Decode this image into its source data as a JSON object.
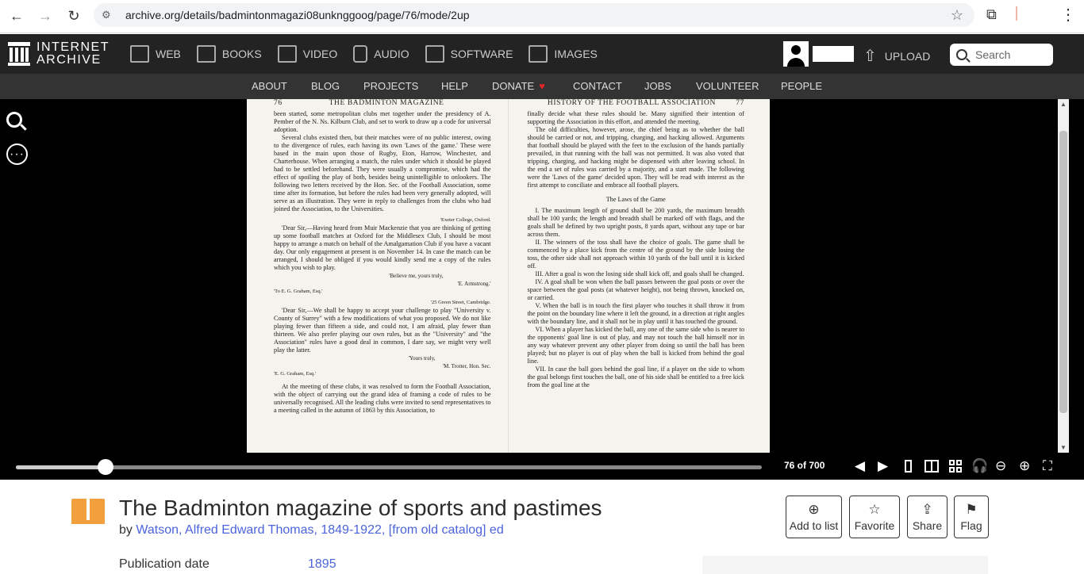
{
  "browser": {
    "url": "archive.org/details/badmintonmagazi08unknggoog/page/76/mode/2up"
  },
  "ia_nav": {
    "logo_line1": "INTERNET",
    "logo_line2": "ARCHIVE",
    "media": [
      {
        "label": "WEB",
        "icon": "web-icon"
      },
      {
        "label": "BOOKS",
        "icon": "books-icon"
      },
      {
        "label": "VIDEO",
        "icon": "video-icon"
      },
      {
        "label": "AUDIO",
        "icon": "audio-icon"
      },
      {
        "label": "SOFTWARE",
        "icon": "software-icon"
      },
      {
        "label": "IMAGES",
        "icon": "images-icon"
      }
    ],
    "upload_label": "UPLOAD",
    "search_placeholder": "Search",
    "sub": [
      "ABOUT",
      "BLOG",
      "PROJECTS",
      "HELP",
      "DONATE",
      "CONTACT",
      "JOBS",
      "VOLUNTEER",
      "PEOPLE"
    ]
  },
  "book": {
    "left_page_number": "76",
    "left_running_head": "THE BADMINTON MAGAZINE",
    "right_running_head": "HISTORY OF THE FOOTBALL ASSOCIATION",
    "right_page_number": "77",
    "left_text": [
      "been started, some metropolitan clubs met together under the presidency of A. Pember of the N. Ns. Kilburn Club, and set to work to draw up a code for universal adoption.",
      "Several clubs existed then, but their matches were of no public interest, owing to the divergence of rules, each having its own 'Laws of the game.' These were based in the main upon those of Rugby, Eton, Harrow, Winchester, and Charterhouse. When arranging a match, the rules under which it should be played had to be settled beforehand. They were usually a compromise, which had the effect of spoiling the play of both, besides being unintelligible to onlookers. The following two letters received by the Hon. Sec. of the Football Association, some time after its formation, but before the rules had been very generally adopted, will serve as an illustration. They were in reply to challenges from the clubs who had joined the Association, to the Universities."
    ],
    "letter1_address": "'Exeter College, Oxford.",
    "letter1_body": "'Dear Sir,—Having heard from Muir Mackenzie that you are thinking of getting up some football matches at Oxford for the Middlesex Club, I should be most happy to arrange a match on behalf of the Amalgamation Club if you have a vacant day. Our only engagement at present is on November 14. In case the match can be arranged, I should be obliged if you would kindly send me a copy of the rules which you wish to play.",
    "letter1_close": "'Believe me, yours truly,",
    "letter1_sign": "'E. Armstrong.'",
    "letter1_to": "'To E. G. Graham, Esq.'",
    "letter2_address": "'25 Green Street, Cambridge.",
    "letter2_body": "'Dear Sir,—We shall be happy to accept your challenge to play \"University v. County of Surrey\" with a few modifications of what you proposed. We do not like playing fewer than fifteen a side, and could not, I am afraid, play fewer than thirteen. We also prefer playing our own rules, but as the \"University\" and \"the Association\" rules have a good deal in common, I dare say, we might very well play the latter.",
    "letter2_close": "'Yours truly,",
    "letter2_sign": "'M. Trotter, Hon. Sec.",
    "letter2_to": "'E. G. Graham, Esq.'",
    "left_closing": "At the meeting of these clubs, it was resolved to form the Football Association, with the object of carrying out the grand idea of framing a code of rules to be universally recognised. All the leading clubs were invited to send representatives to a meeting called in the autumn of 1863 by this Association, to",
    "right_text": [
      "finally decide what these rules should be. Many signified their intention of supporting the Association in this effort, and attended the meeting.",
      "The old difficulties, however, arose, the chief being as to whether the ball should be carried or not, and tripping, charging, and hacking allowed. Arguments that football should be played with the feet to the exclusion of the hands partially prevailed, in that running with the ball was not permitted. It was also voted that tripping, charging, and hacking might be dispensed with after leaving school. In the end a set of rules was carried by a majority, and a start made. The following were the 'Laws of the game' decided upon. They will be read with interest as the first attempt to conciliate and embrace all football players."
    ],
    "laws_heading": "The Laws of the Game",
    "laws": [
      "I. The maximum length of ground shall be 200 yards, the maximum breadth shall be 100 yards; the length and breadth shall be marked off with flags, and the goals shall be defined by two upright posts, 8 yards apart, without any tape or bar across them.",
      "II. The winners of the toss shall have the choice of goals. The game shall be commenced by a place kick from the centre of the ground by the side losing the toss, the other side shall not approach within 10 yards of the ball until it is kicked off.",
      "III. After a goal is won the losing side shall kick off, and goals shall be changed.",
      "IV. A goal shall be won when the ball passes between the goal posts or over the space between the goal posts (at whatever height), not being thrown, knocked on, or carried.",
      "V. When the ball is in touch the first player who touches it shall throw it from the point on the boundary line where it left the ground, in a direction at right angles with the boundary line, and it shall not be in play until it has touched the ground.",
      "VI. When a player has kicked the ball, any one of the same side who is nearer to the opponents' goal line is out of play, and may not touch the ball himself nor in any way whatever prevent any other player from doing so until the ball has been played; but no player is out of play when the ball is kicked from behind the goal line.",
      "VII. In case the ball goes behind the goal line, if a player on the side to whom the goal belongs first touches the ball, one of his side shall be entitled to a free kick from the goal line at the"
    ]
  },
  "reader_controls": {
    "page_count": "76 of 700",
    "progress": 0.12
  },
  "item": {
    "title": "The Badminton magazine of sports and pastimes",
    "by_label": "by",
    "author": "Watson, Alfred Edward Thomas, 1849-1922, [from old catalog] ed",
    "pub_label": "Publication date",
    "pub_value": "1895",
    "actions": [
      {
        "label": "Add to list",
        "icon": "⊕"
      },
      {
        "label": "Favorite",
        "icon": "☆"
      },
      {
        "label": "Share",
        "icon": "⇪"
      },
      {
        "label": "Flag",
        "icon": "⚑"
      }
    ]
  }
}
